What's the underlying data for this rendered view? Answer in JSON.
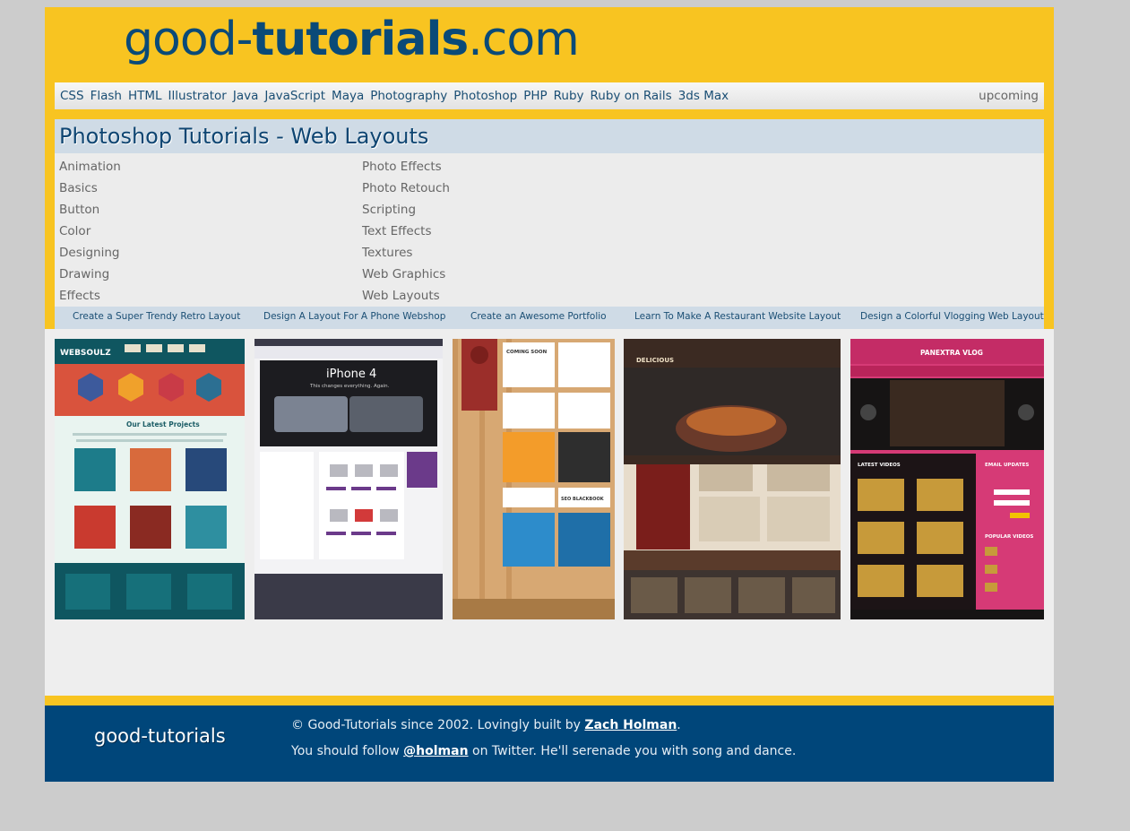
{
  "site": {
    "logo_light": "good-",
    "logo_bold": "tutorials",
    "logo_tld": ".com"
  },
  "nav": {
    "items": [
      "CSS",
      "Flash",
      "HTML",
      "Illustrator",
      "Java",
      "JavaScript",
      "Maya",
      "Photography",
      "Photoshop",
      "PHP",
      "Ruby",
      "Ruby on Rails",
      "3ds Max"
    ],
    "upcoming": "upcoming"
  },
  "panel": {
    "title": "Photoshop Tutorials - Web Layouts",
    "categories_left": [
      "Animation",
      "Basics",
      "Button",
      "Color",
      "Designing",
      "Drawing",
      "Effects"
    ],
    "categories_right": [
      "Photo Effects",
      "Photo Retouch",
      "Scripting",
      "Text Effects",
      "Textures",
      "Web Graphics",
      "Web Layouts"
    ]
  },
  "featured": [
    "Create a Super Trendy Retro Layout",
    "Design A Layout For A Phone Webshop",
    "Create an Awesome Portfolio",
    "Learn To Make A Restaurant Website Layout",
    "Design a Colorful Vlogging Web Layout"
  ],
  "thumbs": {
    "t1": {
      "brand": "WEBSOULZ",
      "heading": "Our Latest Projects"
    },
    "t2": {
      "product": "iPhone 4",
      "tagline": "This changes everything. Again."
    },
    "t3": {
      "coming": "COMING SOON",
      "seo": "SEO BLACKBOOK"
    },
    "t4": {
      "brand": "DELICIOUS"
    },
    "t5": {
      "brand": "PANEXTRA VLOG",
      "latest": "LATEST VIDEOS",
      "email": "EMAIL UPDATES",
      "popular": "POPULAR VIDEOS"
    }
  },
  "footer": {
    "logo": "good-tutorials",
    "line1_prefix": "© Good-Tutorials since 2002. Lovingly built by ",
    "line1_link": "Zach Holman",
    "line1_suffix": ".",
    "line2_prefix": "You should follow ",
    "line2_link": "@holman",
    "line2_suffix": " on Twitter. He'll serenade you with song and dance."
  },
  "colors": {
    "brand_yellow": "#f8c421",
    "brand_blue": "#00467a",
    "logo_blue": "#0a4a78",
    "panel_blue": "#cfdbe6"
  }
}
